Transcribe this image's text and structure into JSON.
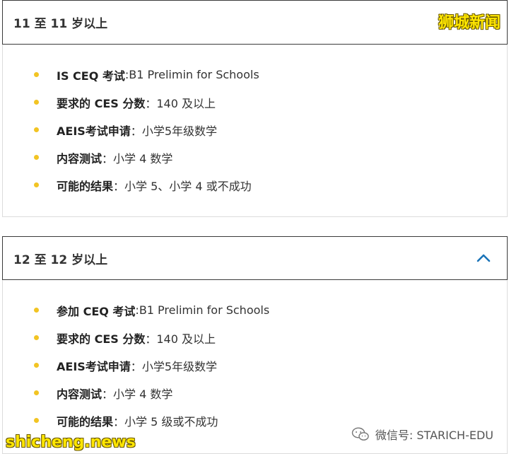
{
  "sections": [
    {
      "title": "11 至 11 岁以上",
      "expanded": true,
      "items": [
        {
          "label": "IS CEQ 考试",
          "sep": ": ",
          "value": "B1 Prelimin for Schools"
        },
        {
          "label": "要求的 CES 分数",
          "sep": "：",
          "value": "140 及以上"
        },
        {
          "label": "AEIS考试申请",
          "sep": "：",
          "value": "小学5年级数学"
        },
        {
          "label": "内容测试",
          "sep": "：",
          "value": "小学 4 数学"
        },
        {
          "label": "可能的结果",
          "sep": "：",
          "value": "小学 5、小学 4 或不成功"
        }
      ]
    },
    {
      "title": "12 至 12 岁以上",
      "expanded": true,
      "items": [
        {
          "label": "参加 CEQ 考试",
          "sep": ": ",
          "value": "B1 Prelimin for Schools"
        },
        {
          "label": "要求的 CES 分数",
          "sep": "：",
          "value": "140 及以上"
        },
        {
          "label": "AEIS考试申请",
          "sep": "：",
          "value": "小学5年级数学"
        },
        {
          "label": "内容测试",
          "sep": "：",
          "value": "小学 4 数学"
        },
        {
          "label": "可能的结果",
          "sep": "：",
          "value": "小学 5 级或不成功"
        }
      ]
    }
  ],
  "watermarks": {
    "top_right": "狮城新闻",
    "bottom_left": "shicheng.news",
    "bottom_right": "微信号: STARICH-EDU"
  },
  "colors": {
    "bullet": "#f2c423",
    "chevron": "#1a73b8",
    "header_border": "#3a3a3a",
    "panel_border": "#dcdcdc"
  },
  "icons": {
    "expand": "chevron-up-icon",
    "bullet": "bullet-dot",
    "wechat": "wechat-icon"
  }
}
